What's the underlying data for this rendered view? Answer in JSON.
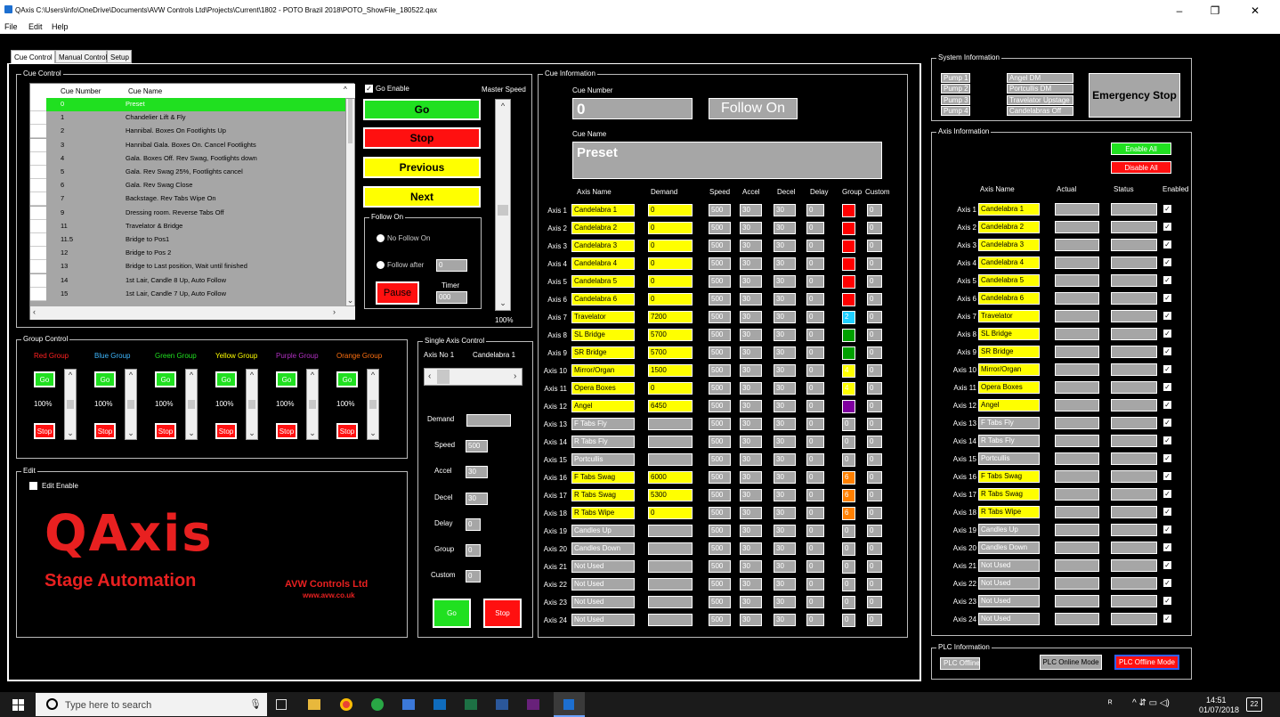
{
  "window": {
    "title": "QAxis  C:\\Users\\info\\OneDrive\\Documents\\AVW Controls Ltd\\Projects\\Current\\1802 - POTO Brazil 2018\\POTO_ShowFile_180522.qax",
    "min": "–",
    "max": "❐",
    "close": "✕"
  },
  "menu": [
    "File",
    "Edit",
    "Help"
  ],
  "tabs": [
    "Cue Control",
    "Manual Control",
    "Setup"
  ],
  "cue_control": {
    "legend": "Cue Control",
    "headers": [
      "Cue Number",
      "Cue Name"
    ],
    "rows": [
      [
        "0",
        "Preset"
      ],
      [
        "1",
        "Chandelier Lift & Fly"
      ],
      [
        "2",
        "Hannibal. Boxes On Footlights Up"
      ],
      [
        "3",
        "Hannibal Gala. Boxes On. Cancel Footlights"
      ],
      [
        "4",
        "Gala. Boxes Off. Rev Swag, Footlights down"
      ],
      [
        "5",
        "Gala. Rev Swag 25%, Footlights cancel"
      ],
      [
        "6",
        "Gala. Rev Swag Close"
      ],
      [
        "7",
        "Backstage. Rev Tabs Wipe On"
      ],
      [
        "9",
        "Dressing room. Reverse Tabs Off"
      ],
      [
        "11",
        "Travelator & Bridge"
      ],
      [
        "11.5",
        "Bridge to Pos1"
      ],
      [
        "12",
        "Bridge to Pos 2"
      ],
      [
        "13",
        "Bridge to Last position, Wait until finished"
      ],
      [
        "14",
        "1st Lair, Candle 8 Up, Auto Follow"
      ],
      [
        "15",
        "1st Lair, Candle 7 Up, Auto Follow"
      ]
    ],
    "go_enable": "Go Enable",
    "master_speed": "Master Speed",
    "master_speed_value": "100%",
    "go": "Go",
    "stop": "Stop",
    "previous": "Previous",
    "next": "Next",
    "follow_on": {
      "legend": "Follow On",
      "no_follow": "No Follow On",
      "follow_after": "Follow after",
      "follow_after_value": "0",
      "pause": "Pause",
      "timer_label": "Timer",
      "timer_value": "000"
    }
  },
  "group_control": {
    "legend": "Group Control",
    "groups": [
      {
        "name": "Red Group",
        "color": "#ff2020",
        "pct": "100%"
      },
      {
        "name": "Blue Group",
        "color": "#3fb8ff",
        "pct": "100%"
      },
      {
        "name": "Green Group",
        "color": "#20e020",
        "pct": "100%"
      },
      {
        "name": "Yellow Group",
        "color": "#ffff00",
        "pct": "100%"
      },
      {
        "name": "Purple Group",
        "color": "#b030c0",
        "pct": "100%"
      },
      {
        "name": "Orange Group",
        "color": "#ff7010",
        "pct": "100%"
      }
    ],
    "go": "Go",
    "stop": "Stop"
  },
  "edit": {
    "legend": "Edit",
    "enable": "Edit Enable",
    "logo": "QAxis",
    "subtitle": "Stage Automation",
    "company": "AVW Controls Ltd",
    "url": "www.avw.co.uk"
  },
  "single_axis": {
    "legend": "Single Axis Control",
    "axis_no": "Axis No 1",
    "axis_name": "Candelabra 1",
    "labels": [
      "Demand",
      "Speed",
      "Accel",
      "Decel",
      "Delay",
      "Group",
      "Custom"
    ],
    "values": [
      "",
      "500",
      "30",
      "30",
      "0",
      "0",
      "0"
    ],
    "go": "Go",
    "stop": "Stop"
  },
  "cue_info": {
    "legend": "Cue Information",
    "cue_number_label": "Cue Number",
    "cue_number": "0",
    "follow_on": "Follow On",
    "cue_name_label": "Cue Name",
    "cue_name": "Preset",
    "headers": [
      "Axis Name",
      "Demand",
      "Speed",
      "Accel",
      "Decel",
      "Delay",
      "Group",
      "Custom"
    ],
    "axes": [
      {
        "label": "Axis 1",
        "name": "Candelabra 1",
        "demand": "0",
        "speed": "500",
        "accel": "30",
        "decel": "30",
        "delay": "0",
        "group": "",
        "gcolor": "#ff0000",
        "custom": "0",
        "y": true,
        "dy": true
      },
      {
        "label": "Axis 2",
        "name": "Candelabra 2",
        "demand": "0",
        "speed": "500",
        "accel": "30",
        "decel": "30",
        "delay": "0",
        "group": "",
        "gcolor": "#ff0000",
        "custom": "0",
        "y": true,
        "dy": true
      },
      {
        "label": "Axis 3",
        "name": "Candelabra 3",
        "demand": "0",
        "speed": "500",
        "accel": "30",
        "decel": "30",
        "delay": "0",
        "group": "",
        "gcolor": "#ff0000",
        "custom": "0",
        "y": true,
        "dy": true
      },
      {
        "label": "Axis 4",
        "name": "Candelabra 4",
        "demand": "0",
        "speed": "500",
        "accel": "30",
        "decel": "30",
        "delay": "0",
        "group": "",
        "gcolor": "#ff0000",
        "custom": "0",
        "y": true,
        "dy": true
      },
      {
        "label": "Axis 5",
        "name": "Candelabra 5",
        "demand": "0",
        "speed": "500",
        "accel": "30",
        "decel": "30",
        "delay": "0",
        "group": "",
        "gcolor": "#ff0000",
        "custom": "0",
        "y": true,
        "dy": true
      },
      {
        "label": "Axis 6",
        "name": "Candelabra 6",
        "demand": "0",
        "speed": "500",
        "accel": "30",
        "decel": "30",
        "delay": "0",
        "group": "",
        "gcolor": "#ff0000",
        "custom": "0",
        "y": true,
        "dy": true
      },
      {
        "label": "Axis 7",
        "name": "Travelator",
        "demand": "7200",
        "speed": "500",
        "accel": "30",
        "decel": "30",
        "delay": "0",
        "group": "2",
        "gcolor": "#20d0ff",
        "custom": "0",
        "y": true,
        "dy": true
      },
      {
        "label": "Axis 8",
        "name": "SL Bridge",
        "demand": "5700",
        "speed": "500",
        "accel": "30",
        "decel": "30",
        "delay": "0",
        "group": "",
        "gcolor": "#00a000",
        "custom": "0",
        "y": true,
        "dy": true
      },
      {
        "label": "Axis 9",
        "name": "SR Bridge",
        "demand": "5700",
        "speed": "500",
        "accel": "30",
        "decel": "30",
        "delay": "0",
        "group": "",
        "gcolor": "#00a000",
        "custom": "0",
        "y": true,
        "dy": true
      },
      {
        "label": "Axis 10",
        "name": "Mirror/Organ",
        "demand": "1500",
        "speed": "500",
        "accel": "30",
        "decel": "30",
        "delay": "0",
        "group": "4",
        "gcolor": "#ffff00",
        "custom": "0",
        "y": true,
        "dy": true
      },
      {
        "label": "Axis 11",
        "name": "Opera Boxes",
        "demand": "0",
        "speed": "500",
        "accel": "30",
        "decel": "30",
        "delay": "0",
        "group": "4",
        "gcolor": "#ffff00",
        "custom": "0",
        "y": true,
        "dy": true
      },
      {
        "label": "Axis 12",
        "name": "Angel",
        "demand": "6450",
        "speed": "500",
        "accel": "30",
        "decel": "30",
        "delay": "0",
        "group": "",
        "gcolor": "#8000a0",
        "custom": "0",
        "y": true,
        "dy": true
      },
      {
        "label": "Axis 13",
        "name": "F Tabs Fly",
        "demand": "",
        "speed": "500",
        "accel": "30",
        "decel": "30",
        "delay": "0",
        "group": "0",
        "gcolor": "",
        "custom": "0",
        "y": false,
        "dy": false
      },
      {
        "label": "Axis 14",
        "name": "R Tabs Fly",
        "demand": "",
        "speed": "500",
        "accel": "30",
        "decel": "30",
        "delay": "0",
        "group": "0",
        "gcolor": "",
        "custom": "0",
        "y": false,
        "dy": false
      },
      {
        "label": "Axis 15",
        "name": "Portcullis",
        "demand": "",
        "speed": "500",
        "accel": "30",
        "decel": "30",
        "delay": "0",
        "group": "0",
        "gcolor": "",
        "custom": "0",
        "y": false,
        "dy": false
      },
      {
        "label": "Axis 16",
        "name": "F Tabs Swag",
        "demand": "6000",
        "speed": "500",
        "accel": "30",
        "decel": "30",
        "delay": "0",
        "group": "6",
        "gcolor": "#ff8000",
        "custom": "0",
        "y": true,
        "dy": true
      },
      {
        "label": "Axis 17",
        "name": "R Tabs Swag",
        "demand": "5300",
        "speed": "500",
        "accel": "30",
        "decel": "30",
        "delay": "0",
        "group": "6",
        "gcolor": "#ff8000",
        "custom": "0",
        "y": true,
        "dy": true
      },
      {
        "label": "Axis 18",
        "name": "R Tabs Wipe",
        "demand": "0",
        "speed": "500",
        "accel": "30",
        "decel": "30",
        "delay": "0",
        "group": "6",
        "gcolor": "#ff8000",
        "custom": "0",
        "y": true,
        "dy": true
      },
      {
        "label": "Axis 19",
        "name": "Candles Up",
        "demand": "",
        "speed": "500",
        "accel": "30",
        "decel": "30",
        "delay": "0",
        "group": "0",
        "gcolor": "",
        "custom": "0",
        "y": false,
        "dy": false
      },
      {
        "label": "Axis 20",
        "name": "Candles Down",
        "demand": "",
        "speed": "500",
        "accel": "30",
        "decel": "30",
        "delay": "0",
        "group": "0",
        "gcolor": "",
        "custom": "0",
        "y": false,
        "dy": false
      },
      {
        "label": "Axis 21",
        "name": "Not Used",
        "demand": "",
        "speed": "500",
        "accel": "30",
        "decel": "30",
        "delay": "0",
        "group": "0",
        "gcolor": "",
        "custom": "0",
        "y": false,
        "dy": false
      },
      {
        "label": "Axis 22",
        "name": "Not Used",
        "demand": "",
        "speed": "500",
        "accel": "30",
        "decel": "30",
        "delay": "0",
        "group": "0",
        "gcolor": "",
        "custom": "0",
        "y": false,
        "dy": false
      },
      {
        "label": "Axis 23",
        "name": "Not Used",
        "demand": "",
        "speed": "500",
        "accel": "30",
        "decel": "30",
        "delay": "0",
        "group": "0",
        "gcolor": "",
        "custom": "0",
        "y": false,
        "dy": false
      },
      {
        "label": "Axis 24",
        "name": "Not Used",
        "demand": "",
        "speed": "500",
        "accel": "30",
        "decel": "30",
        "delay": "0",
        "group": "0",
        "gcolor": "",
        "custom": "0",
        "y": false,
        "dy": false
      }
    ]
  },
  "system_info": {
    "legend": "System Information",
    "pumps": [
      "Pump 1",
      "Pump 2",
      "Pump 3",
      "Pump 4"
    ],
    "statuses": [
      "Angel DM",
      "Portcullis DM",
      "Travelator Upstage",
      "Candelabras Off"
    ],
    "emergency": "Emergency Stop"
  },
  "axis_info": {
    "legend": "Axis Information",
    "enable_all": "Enable All",
    "disable_all": "Disable All",
    "headers": [
      "Axis Name",
      "Actual",
      "Status",
      "Enabled"
    ]
  },
  "plc": {
    "legend": "PLC Information",
    "status": "PLC Offline",
    "online": "PLC Online Mode",
    "offline": "PLC Offline Mode"
  },
  "taskbar": {
    "search": "Type here to search",
    "time": "14:51",
    "date": "01/07/2018",
    "notif": "22"
  }
}
